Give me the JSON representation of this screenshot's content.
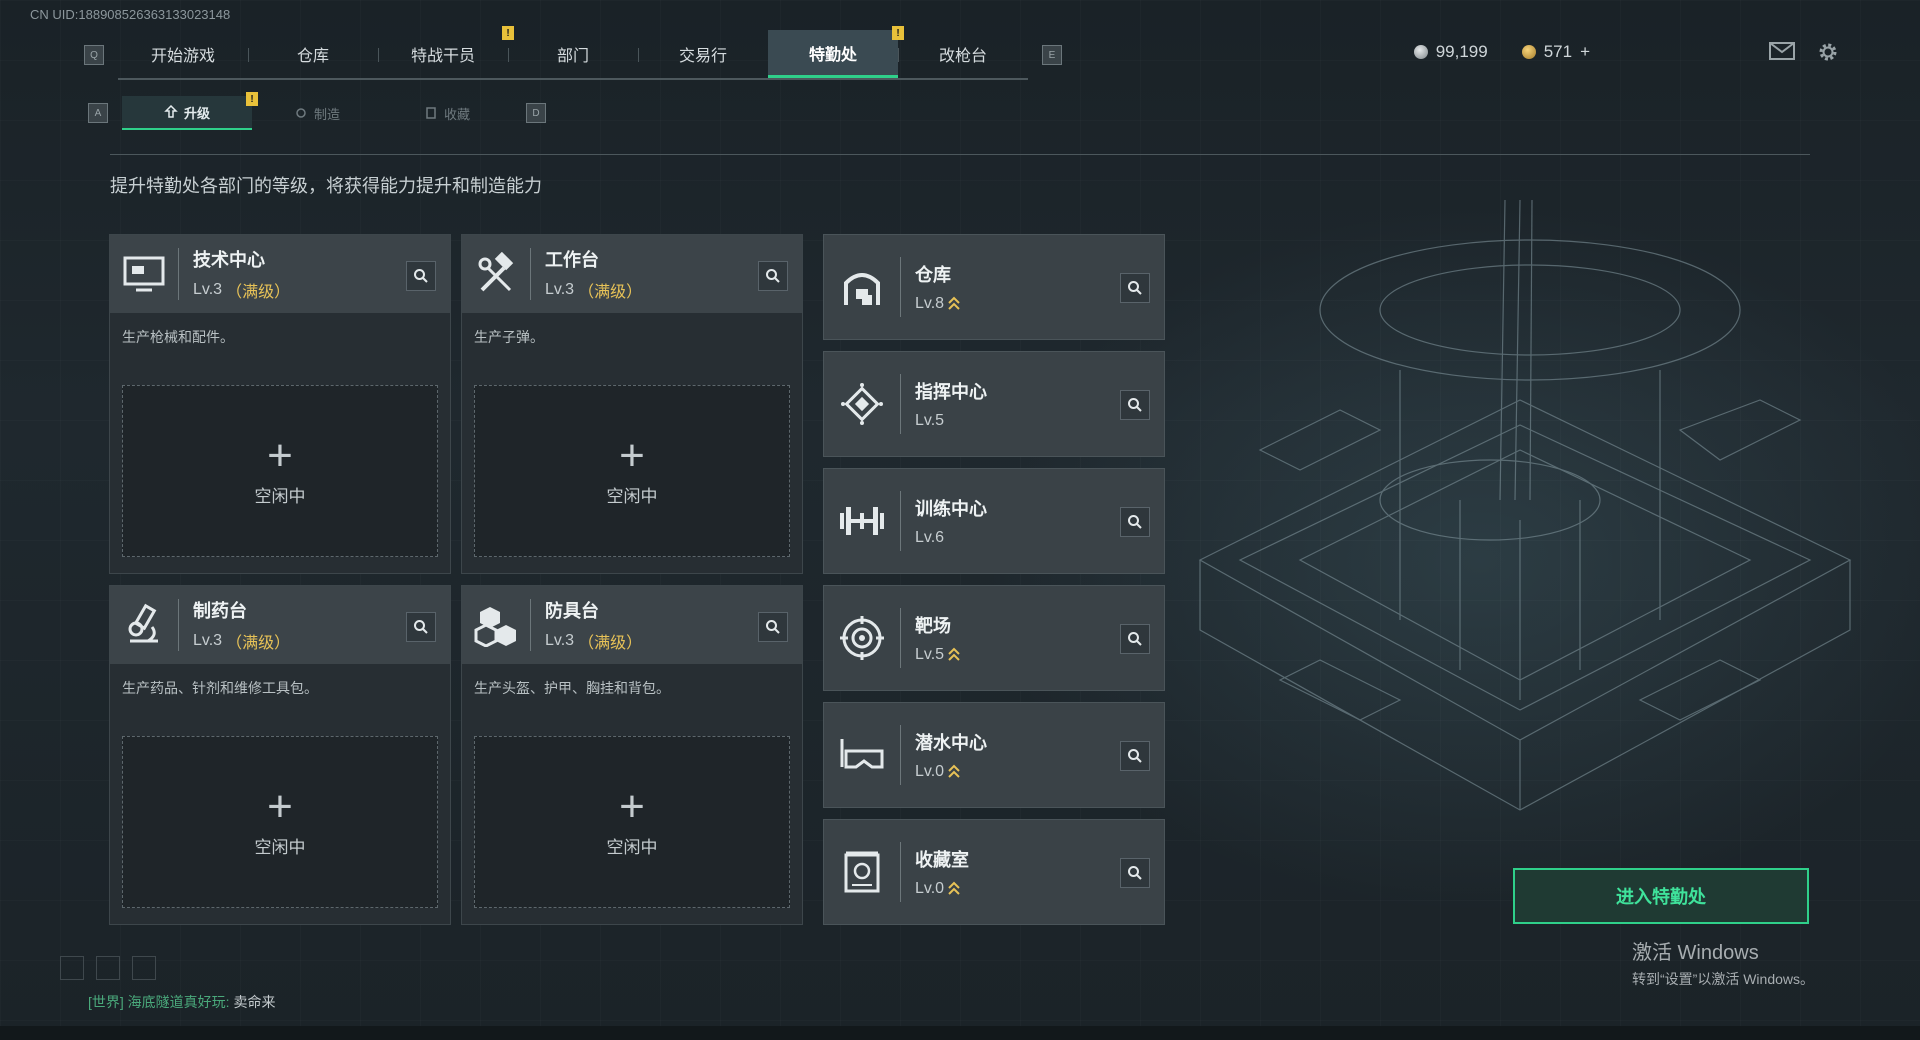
{
  "uid": "CN UID:1889085263631330231​48",
  "topnav": {
    "left_key": "Q",
    "right_key": "E",
    "tabs": [
      {
        "label": "开始游戏",
        "badge": ""
      },
      {
        "label": "仓库",
        "badge": ""
      },
      {
        "label": "特战干员",
        "badge": "!"
      },
      {
        "label": "部门",
        "badge": ""
      },
      {
        "label": "交易行",
        "badge": ""
      },
      {
        "label": "特勤处",
        "badge": "!"
      },
      {
        "label": "改枪台",
        "badge": ""
      }
    ],
    "active_tab": "特勤处"
  },
  "currency": {
    "silver": "99,199",
    "gold": "571",
    "gold_add": "+"
  },
  "subnav": {
    "left_key": "A",
    "right_key": "D",
    "tabs": [
      {
        "label": "升级",
        "badge": "!"
      },
      {
        "label": "制造",
        "badge": ""
      },
      {
        "label": "收藏",
        "badge": ""
      }
    ]
  },
  "description": "提升特勤处各部门的等级，将获得能力提升和制造能力",
  "workshops": [
    {
      "name": "技术中心",
      "level": "Lv.3",
      "max_label": "（满级）",
      "desc": "生产枪械和配件。",
      "plus": "+",
      "status": "空闲中",
      "icon": "monitor-icon"
    },
    {
      "name": "工作台",
      "level": "Lv.3",
      "max_label": "（满级）",
      "desc": "生产子弹。",
      "plus": "+",
      "status": "空闲中",
      "icon": "hammer-wrench-icon"
    },
    {
      "name": "制药台",
      "level": "Lv.3",
      "max_label": "（满级）",
      "desc": "生产药品、针剂和维修工具包。",
      "plus": "+",
      "status": "空闲中",
      "icon": "microscope-icon"
    },
    {
      "name": "防具台",
      "level": "Lv.3",
      "max_label": "（满级）",
      "desc": "生产头盔、护甲、胸挂和背包。",
      "plus": "+",
      "status": "空闲中",
      "icon": "boxes-icon"
    }
  ],
  "facilities": [
    {
      "name": "仓库",
      "level": "Lv.8",
      "upgradable": true,
      "icon": "warehouse-icon"
    },
    {
      "name": "指挥中心",
      "level": "Lv.5",
      "upgradable": false,
      "icon": "command-icon"
    },
    {
      "name": "训练中心",
      "level": "Lv.6",
      "upgradable": false,
      "icon": "dumbbell-icon"
    },
    {
      "name": "靶场",
      "level": "Lv.5",
      "upgradable": true,
      "icon": "target-icon"
    },
    {
      "name": "潜水中心",
      "level": "Lv.0",
      "upgradable": true,
      "icon": "diving-mask-icon"
    },
    {
      "name": "收藏室",
      "level": "Lv.0",
      "upgradable": true,
      "icon": "collection-icon"
    }
  ],
  "enter_button": "进入特勤处",
  "windows_activation": {
    "title": "激活 Windows",
    "subtitle": "转到“设置”以激活 Windows。"
  },
  "chat": {
    "channel": "[世界]",
    "sender": "海底隧道真好玩:",
    "message": "卖命来"
  },
  "colors": {
    "accent": "#2fd08a",
    "max_level": "#e7c257",
    "badge": "#e9c13a"
  }
}
